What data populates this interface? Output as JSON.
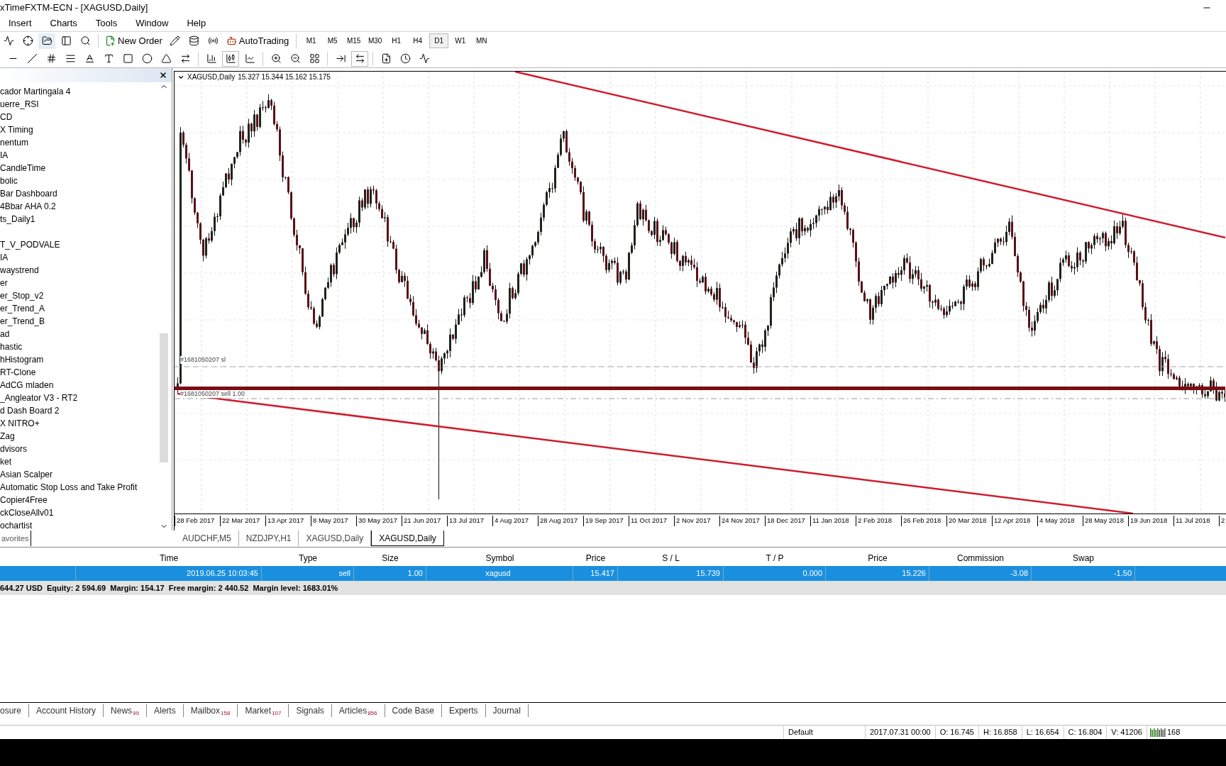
{
  "window": {
    "title": "xTimeFXTM-ECN - [XAGUSD,Daily]"
  },
  "menu": [
    "Insert",
    "Charts",
    "Tools",
    "Window",
    "Help"
  ],
  "toolbar": {
    "new_order": "New Order",
    "auto_trading": "AutoTrading"
  },
  "timeframes": [
    {
      "label": "M1",
      "selected": false
    },
    {
      "label": "M5",
      "selected": false
    },
    {
      "label": "M15",
      "selected": false
    },
    {
      "label": "M30",
      "selected": false
    },
    {
      "label": "H1",
      "selected": false
    },
    {
      "label": "H4",
      "selected": false
    },
    {
      "label": "D1",
      "selected": true
    },
    {
      "label": "W1",
      "selected": false
    },
    {
      "label": "MN",
      "selected": false
    }
  ],
  "navigator": {
    "sections": [
      {
        "items": [
          {
            "label": "cador Martingala 4"
          },
          {
            "label": "uerre_RSI"
          },
          {
            "label": "CD"
          },
          {
            "label": "X Timing"
          },
          {
            "label": "nentum"
          },
          {
            "label": "IA"
          },
          {
            "label": "CandleTime"
          },
          {
            "label": "bolic"
          },
          {
            "label": "Bar Dashboard"
          },
          {
            "label": "4Bbar AHA 0.2"
          },
          {
            "label": "ts_Daily1"
          }
        ]
      },
      {
        "items": [
          {
            "label": "T_V_PODVALE"
          },
          {
            "label": "IA"
          },
          {
            "label": "waystrend"
          },
          {
            "label": "er"
          },
          {
            "label": "er_Stop_v2"
          },
          {
            "label": "er_Trend_A"
          },
          {
            "label": "er_Trend_B"
          },
          {
            "label": "ad"
          },
          {
            "label": "hastic"
          },
          {
            "label": "hHistogram"
          },
          {
            "label": "RT-Clone"
          },
          {
            "label": "AdCG mladen"
          },
          {
            "label": "_Angleator V3 - RT2"
          },
          {
            "label": "d Dash Board 2"
          },
          {
            "label": "X NITRO+"
          },
          {
            "label": "Zag"
          },
          {
            "label": "dvisors"
          },
          {
            "label": "ket"
          },
          {
            "label": "Asian Scalper"
          },
          {
            "label": "Automatic Stop Loss and Take Profit"
          },
          {
            "label": "Copier4Free"
          },
          {
            "label": "ckCloseAllv01"
          },
          {
            "label": "ochartist"
          }
        ]
      }
    ],
    "tab": "avorites"
  },
  "chart": {
    "symbol": "XAGUSD,Daily",
    "ohlc": "15.327 15.344 15.162 15.175",
    "sl_label": "#1681050207 sl",
    "order_label": "#1681050207 sell 1.00",
    "dates": [
      "28 Feb 2017",
      "22 Mar 2017",
      "13 Apr 2017",
      "8 May 2017",
      "30 May 2017",
      "21 Jun 2017",
      "13 Jul 2017",
      "4 Aug 2017",
      "28 Aug 2017",
      "19 Sep 2017",
      "11 Oct 2017",
      "2 Nov 2017",
      "24 Nov 2017",
      "18 Dec 2017",
      "11 Jan 2018",
      "2 Feb 2018",
      "26 Feb 2018",
      "20 Mar 2018",
      "12 Apr 2018",
      "4 May 2018",
      "28 May 2018",
      "19 Jun 2018",
      "11 Jul 2018",
      "2"
    ]
  },
  "chart_tabs": [
    {
      "label": "AUDCHF,M5",
      "selected": false
    },
    {
      "label": "NZDJPY,H1",
      "selected": false
    },
    {
      "label": "XAGUSD,Daily",
      "selected": false
    },
    {
      "label": "XAGUSD,Daily",
      "selected": true
    }
  ],
  "trades": {
    "columns": [
      "Time",
      "Type",
      "Size",
      "Symbol",
      "Price",
      "S / L",
      "T / P",
      "Price",
      "Commission",
      "Swap"
    ],
    "rows": [
      {
        "selected": true,
        "cells": [
          "2019.06.25 10:03:45",
          "sell",
          "1.00",
          "xagusd",
          "15.417",
          "15.739",
          "0.000",
          "15.226",
          "-3.08",
          "-1.50"
        ]
      }
    ],
    "summary": "644.27 USD  Equity: 2 594.69  Margin: 154.17  Free margin: 2 440.52  Margin level: 1683.01%"
  },
  "terminal_tabs": [
    {
      "label": "osure"
    },
    {
      "label": "Account History"
    },
    {
      "label": "News",
      "count": "99"
    },
    {
      "label": "Alerts"
    },
    {
      "label": "Mailbox",
      "count": "158"
    },
    {
      "label": "Market",
      "count": "107"
    },
    {
      "label": "Signals"
    },
    {
      "label": "Articles",
      "count": "856"
    },
    {
      "label": "Code Base"
    },
    {
      "label": "Experts"
    },
    {
      "label": "Journal"
    }
  ],
  "status_bar": [
    "Default",
    "2017.07.31 00:00",
    "O: 16.745",
    "H: 16.858",
    "L: 16.654",
    "C: 16.804",
    "V: 41206"
  ],
  "connection": "168"
}
